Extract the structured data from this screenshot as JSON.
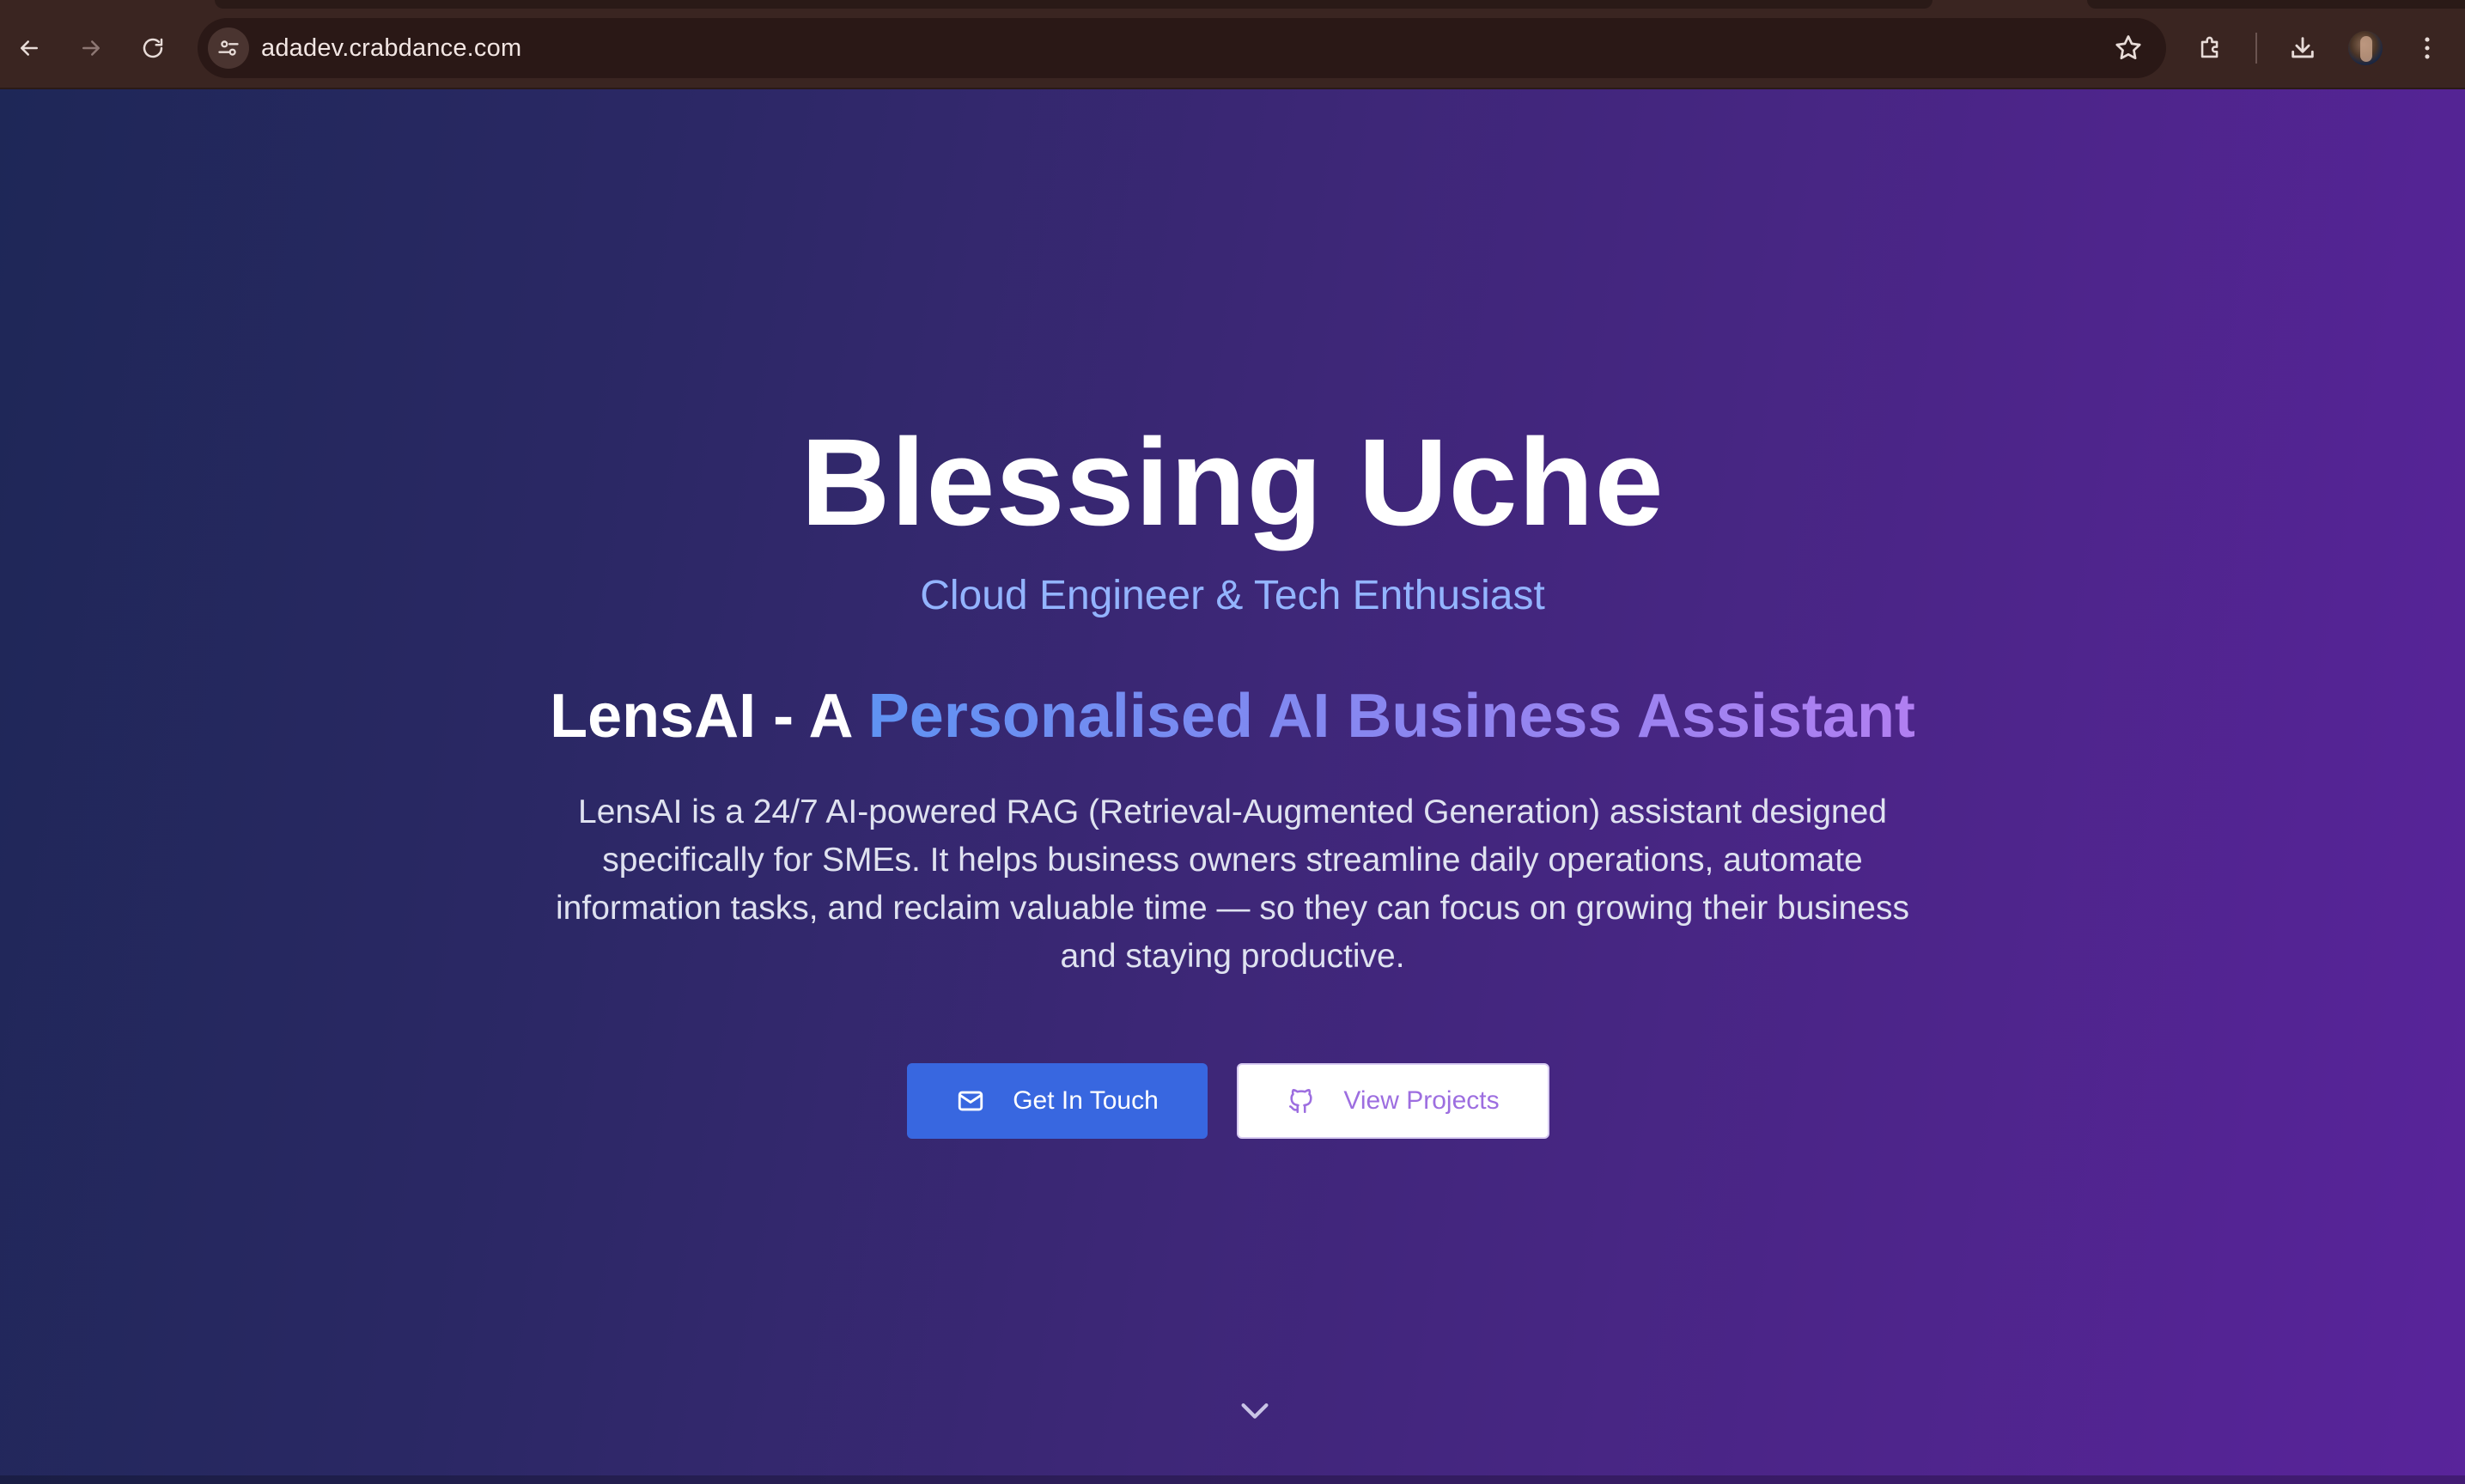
{
  "browser": {
    "url": "adadev.crabdance.com",
    "icons": {
      "back": "arrow-left-icon",
      "forward": "arrow-right-icon",
      "reload": "reload-icon",
      "site_info": "tune-icon",
      "bookmark": "star-icon",
      "extensions": "puzzle-icon",
      "downloads": "download-icon",
      "profile": "avatar",
      "menu": "kebab-menu-icon"
    }
  },
  "hero": {
    "name": "Blessing Uche",
    "tagline": "Cloud Engineer & Tech Enthusiast",
    "project_prefix": "LensAI - A ",
    "project_highlight": "Personalised AI Business Assistant",
    "description": "LensAI is a 24/7 AI-powered RAG (Retrieval-Augmented Generation) assistant designed specifically for SMEs. It helps business owners streamline daily operations, automate information tasks, and reclaim valuable time — so they can focus on growing their business and staying productive.",
    "primary_button": {
      "label": "Get In Touch",
      "icon": "mail-icon"
    },
    "secondary_button": {
      "label": "View Projects",
      "icon": "github-icon"
    },
    "scroll_icon": "chevron-down-icon"
  },
  "colors": {
    "accent_blue": "#3867e0",
    "subtitle_blue": "#93b4ff",
    "gradient_start": "#5f92f2",
    "gradient_end": "#b17ff1",
    "secondary_text": "#9d6ee0",
    "background_left": "#1e2757",
    "background_right": "#59249b",
    "chrome_bg": "#3a2521"
  }
}
